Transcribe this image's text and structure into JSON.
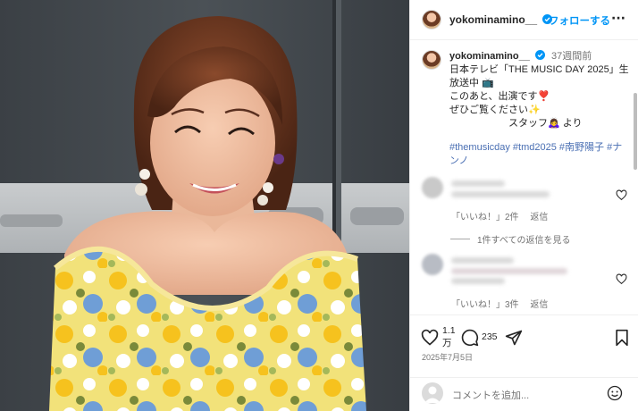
{
  "header": {
    "username": "yokominamino__",
    "follow_label": "フォローする",
    "more_label": "···"
  },
  "caption": {
    "username": "yokominamino__",
    "time_ago": "37週間前",
    "lines": [
      "日本テレビ「THE MUSIC DAY 2025」生",
      "放送中 📺",
      "このあと、出演です❣️",
      "ぜひご覧ください✨",
      "　　　　　　スタッフ🙇‍♀️ より"
    ],
    "hashtags_line1": "#themusicday #tmd2025 #南野陽子 #ナ",
    "hashtags_line2": "ンノ"
  },
  "comments": [
    {
      "likes_label": "「いいね！」2件",
      "reply_label": "返信"
    },
    {
      "likes_label": "「いいね！」3件",
      "reply_label": "返信"
    }
  ],
  "view_replies_label": "1件すべての返信を見る",
  "actions": {
    "like_count_top": "1.1",
    "like_count_bottom": "万",
    "comment_count": "235",
    "date": "2025年7月5日"
  },
  "composer": {
    "placeholder": "コメントを追加..."
  },
  "colors": {
    "accent": "#0095f6",
    "text": "#262626",
    "muted": "#737373",
    "hashtag": "#4a6fb3"
  }
}
